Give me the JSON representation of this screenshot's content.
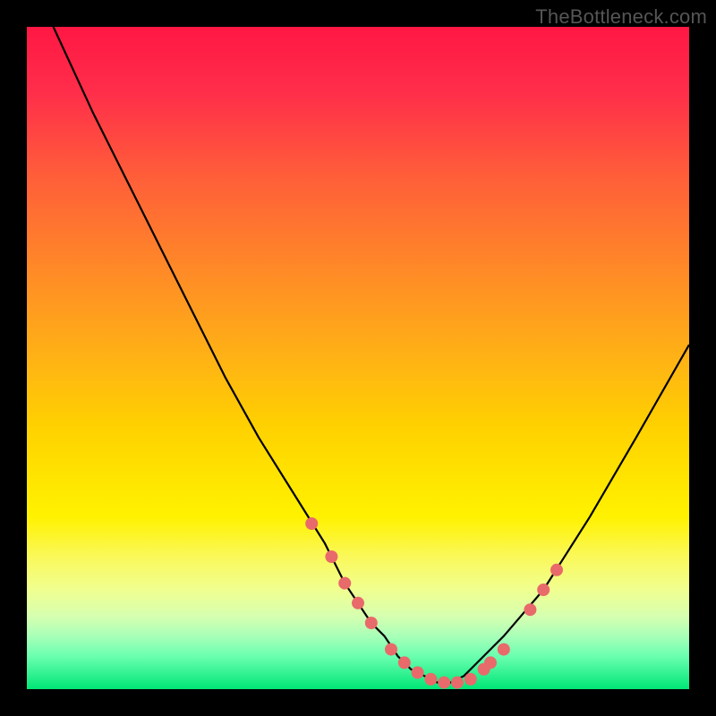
{
  "watermark": "TheBottleneck.com",
  "chart_data": {
    "type": "line",
    "title": "",
    "xlabel": "",
    "ylabel": "",
    "xlim": [
      0,
      100
    ],
    "ylim": [
      0,
      100
    ],
    "series": [
      {
        "name": "bottleneck-curve",
        "x": [
          4,
          10,
          15,
          20,
          25,
          30,
          35,
          40,
          45,
          48,
          50,
          52,
          54,
          56,
          58,
          60,
          62,
          64,
          66,
          68,
          72,
          78,
          85,
          92,
          100
        ],
        "y": [
          100,
          87,
          77,
          67,
          57,
          47,
          38,
          30,
          22,
          16,
          13,
          10,
          8,
          5,
          3,
          2,
          1,
          1,
          2,
          4,
          8,
          15,
          26,
          38,
          52
        ]
      }
    ],
    "markers": {
      "name": "highlighted-dots",
      "x": [
        43,
        46,
        48,
        50,
        52,
        55,
        57,
        59,
        61,
        63,
        65,
        67,
        69,
        70,
        72,
        76,
        78,
        80
      ],
      "y": [
        25,
        20,
        16,
        13,
        10,
        6,
        4,
        2.5,
        1.5,
        1,
        1,
        1.5,
        3,
        4,
        6,
        12,
        15,
        18
      ]
    },
    "gradient": {
      "top_color": "#ff1744",
      "bottom_color": "#00e676",
      "description": "red-yellow-green vertical gradient (high bottleneck to low bottleneck)"
    }
  }
}
